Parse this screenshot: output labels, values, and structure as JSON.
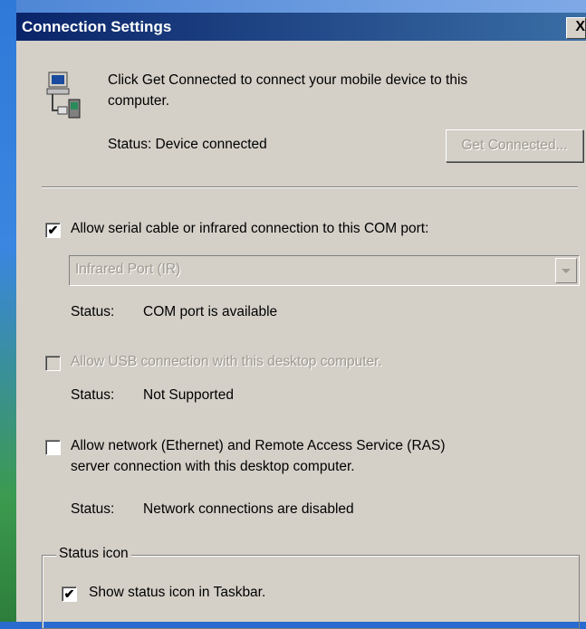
{
  "window": {
    "title": "Connection Settings",
    "close_glyph": "X"
  },
  "intro": {
    "icon": "computer-device-icon",
    "message_line1": "Click Get Connected to connect your mobile device to this",
    "message_line2": "computer.",
    "status_text": "Status: Device connected",
    "get_connected_label": "Get Connected..."
  },
  "serial": {
    "checked": true,
    "label": "Allow serial cable or infrared connection to this COM port:",
    "port_value": "Infrared Port (IR)",
    "status_label": "Status:",
    "status_value": "COM port is available"
  },
  "usb": {
    "checked": false,
    "disabled": true,
    "label": "Allow USB connection with this desktop computer.",
    "status_label": "Status:",
    "status_value": "Not Supported"
  },
  "network": {
    "checked": false,
    "label_line1": "Allow network (Ethernet) and Remote Access Service (RAS)",
    "label_line2": "server connection with this desktop computer.",
    "status_label": "Status:",
    "status_value": "Network connections are disabled"
  },
  "status_icon_group": {
    "legend": "Status icon",
    "show_checked": true,
    "show_label": "Show status icon in Taskbar."
  },
  "colors": {
    "title_gradient_start": "#0a246a",
    "title_gradient_end": "#3a6ea5",
    "dialog_face": "#d4d0c8",
    "disabled_text": "#9e9a90"
  }
}
